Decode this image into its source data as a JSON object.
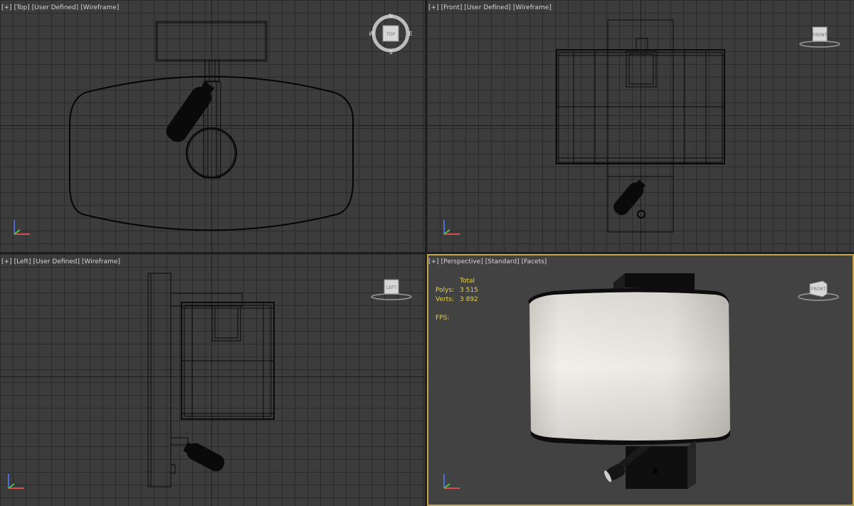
{
  "viewports": {
    "top": {
      "label": [
        "[+]",
        "[Top]",
        "[User Defined]",
        "[Wireframe]"
      ],
      "cube_face": "TOP",
      "compass": {
        "n": "N",
        "s": "S",
        "e": "E",
        "w": "W"
      }
    },
    "front": {
      "label": [
        "[+]",
        "[Front]",
        "[User Defined]",
        "[Wireframe]"
      ],
      "cube_face": "FRONT"
    },
    "left": {
      "label": [
        "[+]",
        "[Left]",
        "[User Defined]",
        "[Wireframe]"
      ],
      "cube_face": "LEFT"
    },
    "perspective": {
      "label": [
        "[+]",
        "[Perspective]",
        "[Standard]",
        "[Facets]"
      ],
      "cube_face": "FRONT",
      "stats": {
        "header": "Total",
        "polys_label": "Polys:",
        "polys_value": "3 515",
        "verts_label": "Verts:",
        "verts_value": "3 892",
        "fps_label": "FPS:"
      }
    }
  },
  "colors": {
    "viewport_bg": "#3c3c3c",
    "grid_line": "#2a2a2a",
    "active_border": "#c8a64a",
    "stats_text": "#e8d24a",
    "shade_fabric": "#ece9e2"
  },
  "icons": {
    "viewcube": "viewcube-icon",
    "axis": "xyz-axis-tripod-icon"
  }
}
